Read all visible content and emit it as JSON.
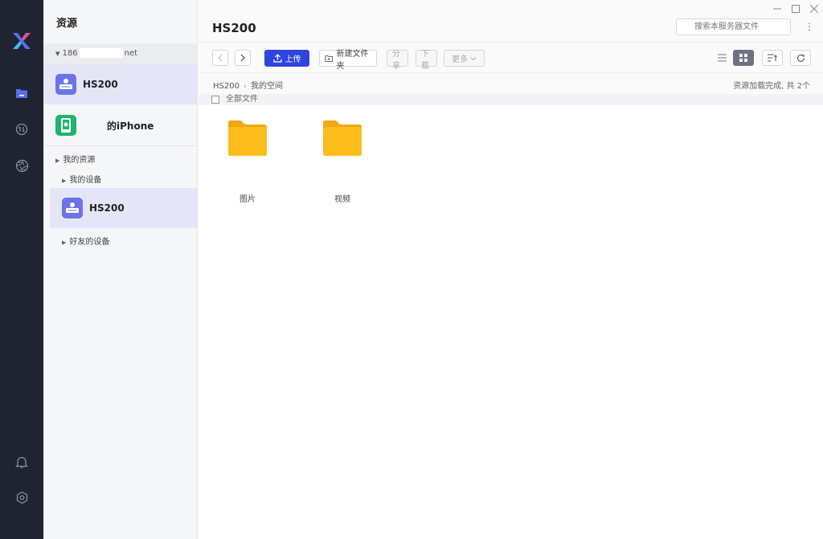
{
  "panel": {
    "title": "资源",
    "account": {
      "prefix": "186",
      "suffix": "net"
    },
    "devices": [
      {
        "name": "HS200",
        "selected": true
      },
      {
        "name": "的iPhone",
        "selected": false
      }
    ],
    "tree": {
      "my_resources": "我的资源",
      "my_devices": "我的设备",
      "device_item": "HS200",
      "friends_devices": "好友的设备"
    }
  },
  "main": {
    "title": "HS200",
    "search": {
      "placeholder": "搜索本服务器文件"
    },
    "toolbar": {
      "upload": "上传",
      "new_folder": "新建文件夹",
      "share": "分享",
      "download": "下载",
      "more": "更多"
    },
    "breadcrumb": {
      "root": "HS200",
      "current": "我的空间"
    },
    "status": "资源加载完成, 共 2个",
    "select_all": "全部文件",
    "files": [
      {
        "name": "图片",
        "type": "folder"
      },
      {
        "name": "视频",
        "type": "folder"
      }
    ]
  },
  "colors": {
    "rail": "#1f2430",
    "primary": "#2f45e0",
    "device_icon": "#6b73e8",
    "phone_icon": "#1fb56a",
    "folder": "#fbb718"
  }
}
